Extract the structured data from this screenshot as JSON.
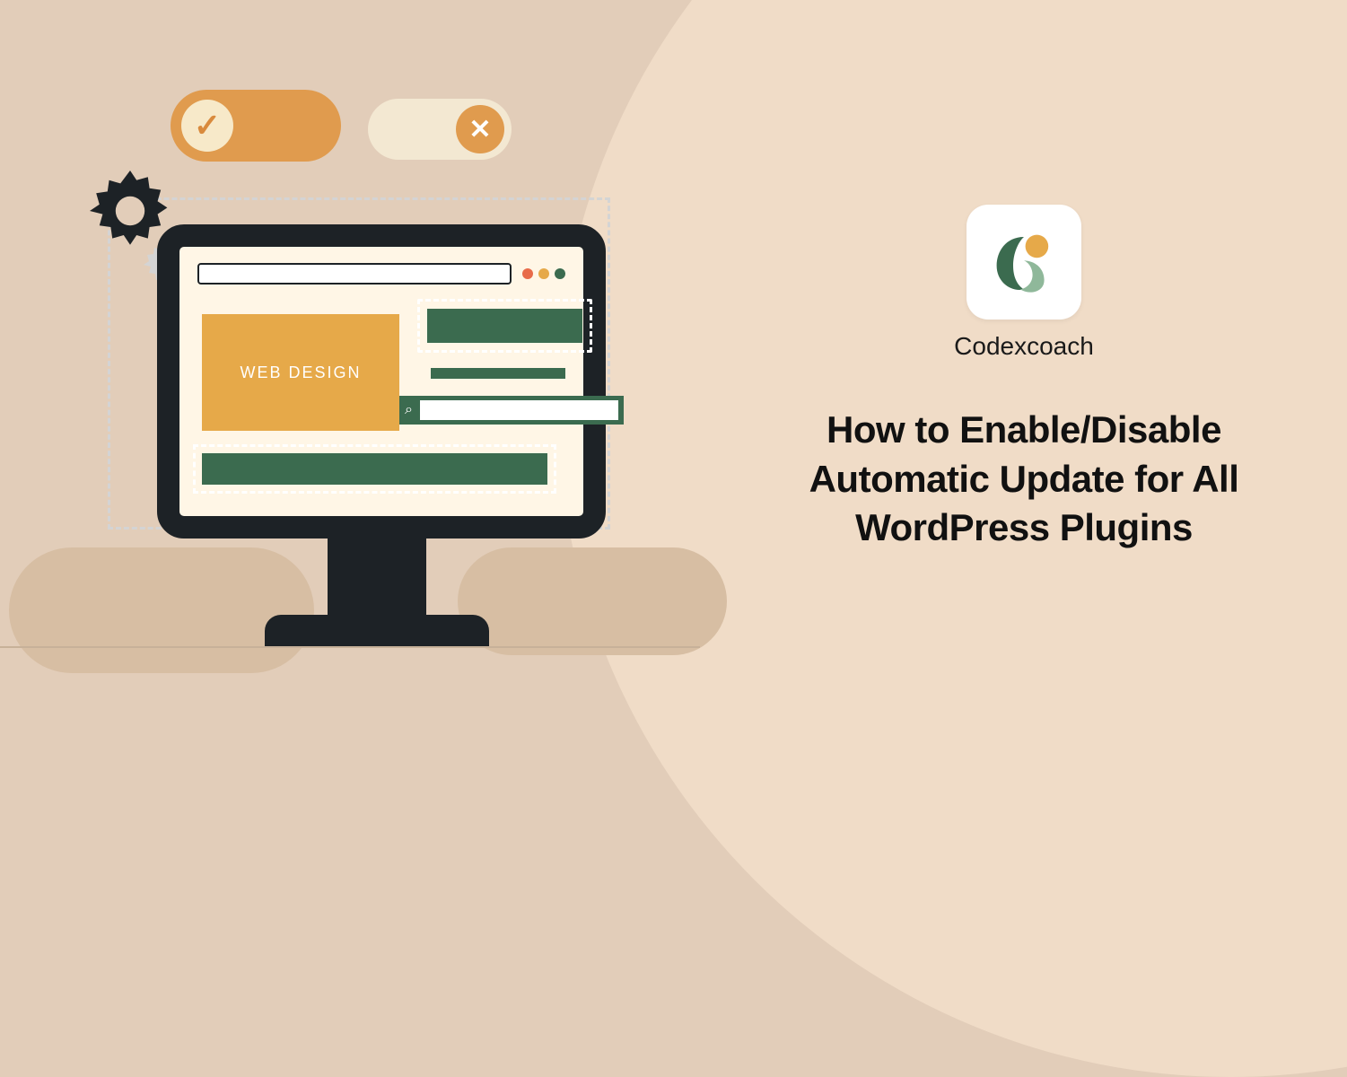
{
  "brand": "Codexcoach",
  "headline": "How to Enable/Disable Automatic Update for All WordPress Plugins",
  "illustration": {
    "card_label": "WEB DESIGN",
    "toggle_on_icon": "✓",
    "toggle_off_icon": "✕",
    "search_icon": "⌕"
  },
  "icons": {
    "gear": "gear-icon",
    "check": "check-icon",
    "cross": "cross-icon",
    "search": "search-icon",
    "logo": "codexcoach-logo"
  }
}
